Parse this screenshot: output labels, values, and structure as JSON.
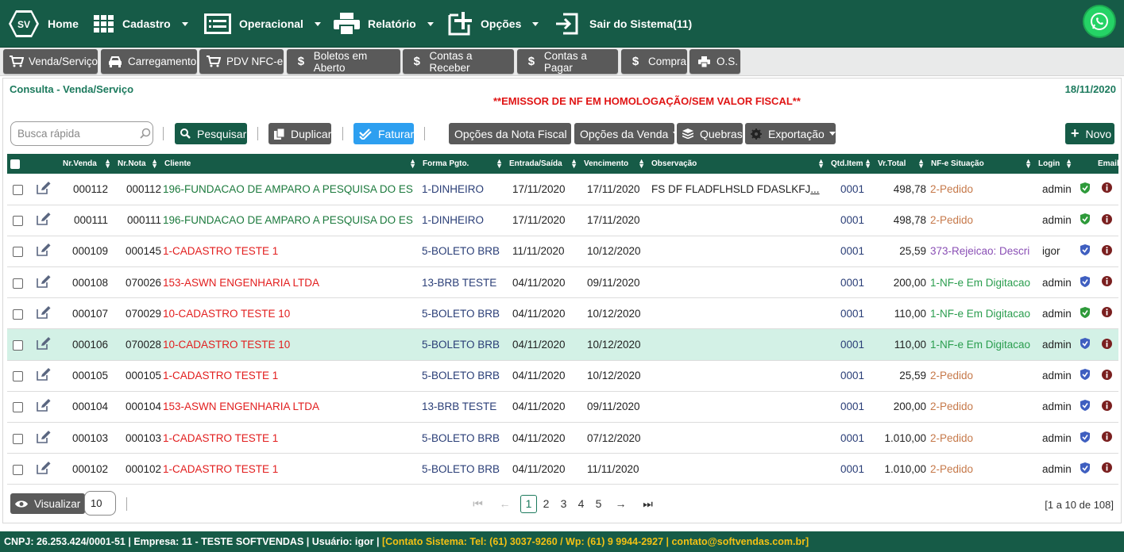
{
  "nav": {
    "logo_text": "SV",
    "items": [
      {
        "label": "Home",
        "icon": "logo-icon"
      },
      {
        "label": "Cadastro",
        "icon": "grid-icon"
      },
      {
        "label": "Operacional",
        "icon": "list-window-icon"
      },
      {
        "label": "Relatório",
        "icon": "printer-icon"
      },
      {
        "label": "Opções",
        "icon": "plus-square-icon"
      },
      {
        "label": "Sair do Sistema(11)",
        "icon": "sign-out-icon"
      }
    ],
    "whatsapp_icon": "whatsapp-icon"
  },
  "shortcuts": [
    {
      "label": "Venda/Serviço",
      "icon": "cart-icon"
    },
    {
      "label": "Carregamento",
      "icon": "car-icon"
    },
    {
      "label": "PDV NFC-e",
      "icon": "cart-icon"
    },
    {
      "label": "Boletos em Aberto",
      "icon": "dollar-icon"
    },
    {
      "label": "Contas a Receber",
      "icon": "dollar-icon"
    },
    {
      "label": "Contas a Pagar",
      "icon": "dollar-icon"
    },
    {
      "label": "Compra",
      "icon": "dollar-icon"
    },
    {
      "label": "O.S.",
      "icon": "printer-icon"
    }
  ],
  "page": {
    "title": "Consulta - Venda/Serviço",
    "date": "18/11/2020",
    "warning": "**EMISSOR DE NF EM HOMOLOGAÇÃO/SEM VALOR FISCAL**"
  },
  "toolbar": {
    "search_placeholder": "Busca rápida",
    "search_value": "",
    "pesquisar": "Pesquisar",
    "duplicar": "Duplicar",
    "faturar": "Faturar",
    "opcoes_nota": "Opções da Nota Fiscal",
    "opcoes_venda": "Opções da Venda",
    "quebras": "Quebras",
    "exportacao": "Exportação",
    "novo": "Novo"
  },
  "table": {
    "columns": [
      "Nr.Venda",
      "Nr.Nota",
      "Cliente",
      "Forma Pgto.",
      "Entrada/Saída",
      "Vencimento",
      "Observação",
      "Qtd.Item",
      "Vr.Total",
      "NF-e Situação",
      "Login",
      "Email"
    ],
    "rows": [
      {
        "venda": "000112",
        "nota": "000112",
        "cliente": "196-FUNDACAO DE AMPARO A PESQUISA DO ES",
        "cliente_color": "green",
        "forma": "1-DINHEIRO",
        "entrada": "17/11/2020",
        "venc": "17/11/2020",
        "obs": "FS DF FLADFLHSLD FDASLKFJ",
        "obs_more": "...",
        "qtd": "0001",
        "total": "498,78",
        "situacao": "2-Pedido",
        "sit_color": "orange",
        "login": "admin",
        "shield": "green",
        "selected": false
      },
      {
        "venda": "000111",
        "nota": "000111",
        "cliente": "196-FUNDACAO DE AMPARO A PESQUISA DO ES",
        "cliente_color": "green",
        "forma": "1-DINHEIRO",
        "entrada": "17/11/2020",
        "venc": "17/11/2020",
        "obs": "",
        "obs_more": "",
        "qtd": "0001",
        "total": "498,78",
        "situacao": "2-Pedido",
        "sit_color": "orange",
        "login": "admin",
        "shield": "green",
        "selected": false
      },
      {
        "venda": "000109",
        "nota": "000145",
        "cliente": "1-CADASTRO TESTE 1",
        "cliente_color": "red",
        "forma": "5-BOLETO BRB",
        "entrada": "11/11/2020",
        "venc": "10/12/2020",
        "obs": "",
        "obs_more": "",
        "qtd": "0001",
        "total": "25,59",
        "situacao": "373-Rejeicao: Descri",
        "sit_color": "purple",
        "login": "igor",
        "shield": "blue",
        "selected": false
      },
      {
        "venda": "000108",
        "nota": "070026",
        "cliente": "153-ASWN ENGENHARIA LTDA",
        "cliente_color": "red",
        "forma": "13-BRB TESTE",
        "entrada": "04/11/2020",
        "venc": "09/11/2020",
        "obs": "",
        "obs_more": "",
        "qtd": "0001",
        "total": "200,00",
        "situacao": "1-NF-e Em Digitacao",
        "sit_color": "green",
        "login": "admin",
        "shield": "blue",
        "selected": false
      },
      {
        "venda": "000107",
        "nota": "070029",
        "cliente": "10-CADASTRO TESTE 10",
        "cliente_color": "red",
        "forma": "5-BOLETO BRB",
        "entrada": "04/11/2020",
        "venc": "10/12/2020",
        "obs": "",
        "obs_more": "",
        "qtd": "0001",
        "total": "110,00",
        "situacao": "1-NF-e Em Digitacao",
        "sit_color": "green",
        "login": "admin",
        "shield": "green",
        "selected": false
      },
      {
        "venda": "000106",
        "nota": "070028",
        "cliente": "10-CADASTRO TESTE 10",
        "cliente_color": "red",
        "forma": "5-BOLETO BRB",
        "entrada": "04/11/2020",
        "venc": "10/12/2020",
        "obs": "",
        "obs_more": "",
        "qtd": "0001",
        "total": "110,00",
        "situacao": "1-NF-e Em Digitacao",
        "sit_color": "green",
        "login": "admin",
        "shield": "blue",
        "selected": true
      },
      {
        "venda": "000105",
        "nota": "000105",
        "cliente": "1-CADASTRO TESTE 1",
        "cliente_color": "red",
        "forma": "5-BOLETO BRB",
        "entrada": "04/11/2020",
        "venc": "10/12/2020",
        "obs": "",
        "obs_more": "",
        "qtd": "0001",
        "total": "25,59",
        "situacao": "2-Pedido",
        "sit_color": "orange",
        "login": "admin",
        "shield": "blue",
        "selected": false
      },
      {
        "venda": "000104",
        "nota": "000104",
        "cliente": "153-ASWN ENGENHARIA LTDA",
        "cliente_color": "red",
        "forma": "13-BRB TESTE",
        "entrada": "04/11/2020",
        "venc": "09/11/2020",
        "obs": "",
        "obs_more": "",
        "qtd": "0001",
        "total": "200,00",
        "situacao": "2-Pedido",
        "sit_color": "orange",
        "login": "admin",
        "shield": "blue",
        "selected": false
      },
      {
        "venda": "000103",
        "nota": "000103",
        "cliente": "1-CADASTRO TESTE 1",
        "cliente_color": "red",
        "forma": "5-BOLETO BRB",
        "entrada": "04/11/2020",
        "venc": "07/12/2020",
        "obs": "",
        "obs_more": "",
        "qtd": "0001",
        "total": "1.010,00",
        "situacao": "2-Pedido",
        "sit_color": "orange",
        "login": "admin",
        "shield": "blue",
        "selected": false
      },
      {
        "venda": "000102",
        "nota": "000102",
        "cliente": "1-CADASTRO TESTE 1",
        "cliente_color": "red",
        "forma": "5-BOLETO BRB",
        "entrada": "04/11/2020",
        "venc": "11/11/2020",
        "obs": "",
        "obs_more": "",
        "qtd": "0001",
        "total": "1.010,00",
        "situacao": "2-Pedido",
        "sit_color": "orange",
        "login": "admin",
        "shield": "blue",
        "selected": false
      }
    ]
  },
  "pagination": {
    "visualizar": "Visualizar",
    "page_size": "10",
    "pages": [
      "1",
      "2",
      "3",
      "4",
      "5"
    ],
    "current": "1",
    "range": "[1 a 10 de 108]"
  },
  "statusbar": {
    "info": "CNPJ: 26.253.424/0001-51 | Empresa: 11 - TESTE SOFTVENDAS | Usuário: igor |",
    "contact": "[Contato Sistema: Tel: (61) 3037-9260 / Wp: (61) 9 9944-2927 | contato@softvendas.com.br]"
  },
  "colors": {
    "brand": "#165b47",
    "brand_text": "#1c7a5d",
    "warning": "#e01414",
    "selected_row": "#d3f1e6",
    "contact": "#f2c014"
  }
}
